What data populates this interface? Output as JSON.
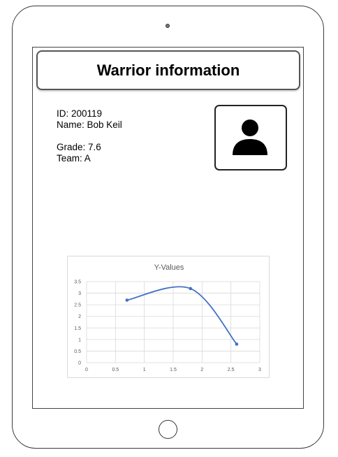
{
  "header": {
    "title": "Warrior information"
  },
  "warrior": {
    "id_line": "ID: 200119",
    "name_line": "Name: Bob Keil",
    "grade_line": "Grade: 7.6",
    "team_line": "Team: A"
  },
  "avatar": {
    "icon": "person-icon"
  },
  "chart_data": {
    "type": "scatter",
    "title": "Y-Values",
    "xlabel": "",
    "ylabel": "",
    "xlim": [
      0,
      3
    ],
    "ylim": [
      0,
      3.5
    ],
    "x_ticks": [
      "0",
      "0.5",
      "1",
      "1.5",
      "2",
      "2.5",
      "3"
    ],
    "y_ticks": [
      "0",
      "0.5",
      "1",
      "1.5",
      "2",
      "2.5",
      "3",
      "3.5"
    ],
    "grid": true,
    "smooth_line": true,
    "series": [
      {
        "x": [
          0.7,
          1.8,
          2.6
        ],
        "y": [
          2.7,
          3.2,
          0.8
        ]
      }
    ],
    "colors": {
      "series": "#4472C4",
      "grid": "#d9d9d9",
      "text": "#595959"
    }
  }
}
